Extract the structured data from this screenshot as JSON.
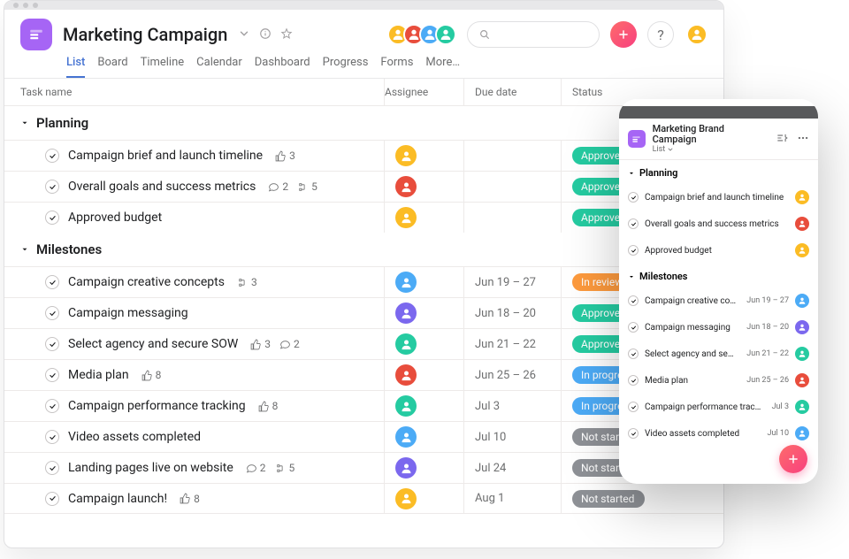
{
  "project": {
    "title": "Marketing Campaign",
    "icon_color": "#a665f5"
  },
  "tabs": [
    {
      "label": "List",
      "active": true
    },
    {
      "label": "Board"
    },
    {
      "label": "Timeline"
    },
    {
      "label": "Calendar"
    },
    {
      "label": "Dashboard"
    },
    {
      "label": "Progress"
    },
    {
      "label": "Forms"
    },
    {
      "label": "More…"
    }
  ],
  "header_avatars": [
    {
      "color": "#fbbc25"
    },
    {
      "color": "#e84d3c"
    },
    {
      "color": "#4cabf6"
    },
    {
      "color": "#25cba1"
    }
  ],
  "current_user_avatar": {
    "color": "#fbbc25"
  },
  "columns": {
    "name": "Task name",
    "assignee": "Assignee",
    "date": "Due date",
    "status": "Status"
  },
  "sections": [
    {
      "name": "Planning",
      "tasks": [
        {
          "name": "Campaign brief and launch timeline",
          "likes": 3,
          "assignee_color": "#fbbc25",
          "status_label": "Approved",
          "status_class": "approved"
        },
        {
          "name": "Overall goals and success metrics",
          "comments": 2,
          "subtasks": 5,
          "assignee_color": "#e84d3c",
          "status_label": "Approved",
          "status_class": "approved"
        },
        {
          "name": "Approved budget",
          "assignee_color": "#fbbc25",
          "status_label": "Approved",
          "status_class": "approved"
        }
      ]
    },
    {
      "name": "Milestones",
      "tasks": [
        {
          "name": "Campaign creative concepts",
          "subtasks": 3,
          "assignee_color": "#4cabf6",
          "date": "Jun 19 – 27",
          "status_label": "In review",
          "status_class": "review"
        },
        {
          "name": "Campaign messaging",
          "assignee_color": "#7b68ee",
          "date": "Jun 18 – 20",
          "status_label": "Approved",
          "status_class": "approved"
        },
        {
          "name": "Select agency and secure SOW",
          "likes": 3,
          "comments": 2,
          "assignee_color": "#25cba1",
          "date": "Jun 21 – 22",
          "status_label": "Approved",
          "status_class": "approved"
        },
        {
          "name": "Media plan",
          "likes": 8,
          "assignee_color": "#e84d3c",
          "date": "Jun 25 – 26",
          "status_label": "In progress",
          "status_class": "progress"
        },
        {
          "name": "Campaign performance tracking",
          "likes": 8,
          "assignee_color": "#25cba1",
          "date": "Jul 3",
          "status_label": "In progress",
          "status_class": "progress"
        },
        {
          "name": "Video assets completed",
          "assignee_color": "#4cabf6",
          "date": "Jul 10",
          "status_label": "Not started",
          "status_class": "notstarted"
        },
        {
          "name": "Landing pages live on website",
          "comments": 2,
          "subtasks": 5,
          "assignee_color": "#7b68ee",
          "date": "Jul 24",
          "status_label": "Not started",
          "status_class": "notstarted"
        },
        {
          "name": "Campaign launch!",
          "likes": 8,
          "assignee_color": "#fbbc25",
          "date": "Aug 1",
          "status_label": "Not started",
          "status_class": "notstarted"
        }
      ]
    }
  ],
  "mobile": {
    "title": "Marketing Brand Campaign",
    "view_label": "List",
    "sections": [
      {
        "name": "Planning",
        "tasks": [
          {
            "name": "Campaign brief and launch timeline",
            "assignee_color": "#fbbc25"
          },
          {
            "name": "Overall goals and success metrics",
            "assignee_color": "#e84d3c"
          },
          {
            "name": "Approved budget",
            "assignee_color": "#fbbc25"
          }
        ]
      },
      {
        "name": "Milestones",
        "tasks": [
          {
            "name": "Campaign creative concepts",
            "date": "Jun 19 – 27",
            "assignee_color": "#4cabf6"
          },
          {
            "name": "Campaign messaging",
            "date": "Jun 18 – 20",
            "assignee_color": "#7b68ee"
          },
          {
            "name": "Select agency and secure SOW",
            "date": "Jun 21 – 22",
            "assignee_color": "#25cba1"
          },
          {
            "name": "Media plan",
            "date": "Jun 25 – 26",
            "assignee_color": "#e84d3c"
          },
          {
            "name": "Campaign performance tracking",
            "date": "Jul 3",
            "assignee_color": "#25cba1"
          },
          {
            "name": "Video assets completed",
            "date": "Jul 10",
            "assignee_color": "#4cabf6"
          }
        ]
      }
    ]
  }
}
